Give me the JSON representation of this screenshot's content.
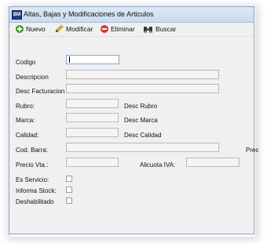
{
  "window": {
    "icon_text": "BM",
    "title": "Altas, Bajas y Modificaciones de Articulos"
  },
  "toolbar": {
    "nuevo": "Nuevo",
    "modificar": "Modificar",
    "eliminar": "Eliminar",
    "buscar": "Buscar"
  },
  "form": {
    "codigo": "Codigo",
    "descripcion": "Descripcion",
    "desc_facturacion": "Desc Facturacion",
    "rubro": "Rubro:",
    "desc_rubro": "Desc Rubro",
    "marca": "Marca:",
    "desc_marca": "Desc Marca",
    "calidad": "Calidad:",
    "desc_calidad": "Desc Calidad",
    "cod_barra": "Cod. Barra:",
    "precio_cut": "Prec",
    "precio_vta": "Precio Vta.:",
    "alicuota_iva": "Alicuota IVA:",
    "es_servicio": "Es Servicio:",
    "informa_stock": "Informa Stock:",
    "deshabilitado": "Deshabilitado"
  },
  "colors": {
    "title_bar": "#cbdaee",
    "nuevo_icon": "#3e9b2c",
    "eliminar_icon": "#d63a2c",
    "active_field_border": "#7ea6d6"
  },
  "icons": {
    "nuevo": "plus-circle-icon",
    "modificar": "pencil-icon",
    "eliminar": "minus-circle-icon",
    "buscar": "binoculars-icon"
  }
}
